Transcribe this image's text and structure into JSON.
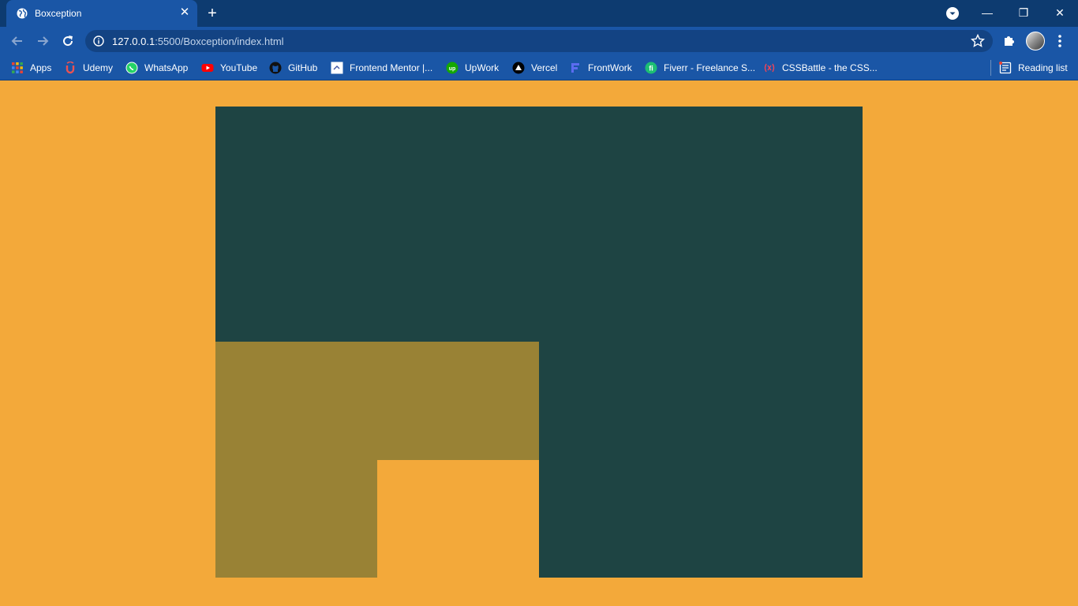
{
  "window": {
    "tab_title": "Boxception",
    "tab_close_glyph": "✕",
    "new_tab_glyph": "+",
    "minimize_glyph": "—",
    "restore_glyph": "❐",
    "close_glyph": "✕"
  },
  "toolbar": {
    "url_host": "127.0.0.1",
    "url_rest": ":5500/Boxception/index.html"
  },
  "bookmarks": [
    {
      "label": "Apps",
      "icon": "apps-grid-icon"
    },
    {
      "label": "Udemy",
      "icon": "udemy-icon"
    },
    {
      "label": "WhatsApp",
      "icon": "whatsapp-icon"
    },
    {
      "label": "YouTube",
      "icon": "youtube-icon"
    },
    {
      "label": "GitHub",
      "icon": "github-icon"
    },
    {
      "label": "Frontend Mentor |...",
      "icon": "frontend-mentor-icon"
    },
    {
      "label": "UpWork",
      "icon": "upwork-icon"
    },
    {
      "label": "Vercel",
      "icon": "vercel-icon"
    },
    {
      "label": "FrontWork",
      "icon": "frontwork-icon"
    },
    {
      "label": "Fiverr - Freelance S...",
      "icon": "fiverr-icon"
    },
    {
      "label": "CSSBattle - the CSS...",
      "icon": "cssbattle-icon"
    }
  ],
  "reading_list": {
    "label": "Reading list",
    "icon": "reading-list-icon"
  },
  "colors": {
    "page_background": "#f3a93a",
    "outer_box": "#1e4443",
    "middle_box": "#998235",
    "inner_box": "#f3a93a",
    "chrome_tab_active": "#1a56a6",
    "chrome_tabbar": "#0d3b70"
  }
}
